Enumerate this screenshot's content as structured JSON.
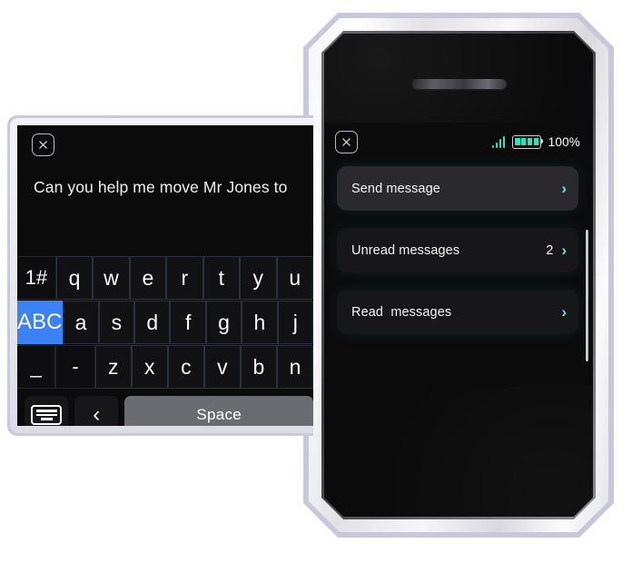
{
  "phone": {
    "status_bar": {
      "close_icon": "close-x-icon",
      "signal_icon": "signal-bars-icon",
      "battery_icon": "battery-full-icon",
      "battery_percent": "100%"
    },
    "menu": [
      {
        "label": "Send message",
        "count": "",
        "chevron": "›",
        "selected": true
      },
      {
        "label": "Unread messages",
        "count": "2",
        "chevron": "›",
        "selected": false
      },
      {
        "label": "Read  messages",
        "count": "",
        "chevron": "›",
        "selected": false
      }
    ]
  },
  "keyboard_panel": {
    "close_icon": "close-x-icon",
    "input_text": "Can you help me move Mr Jones to ",
    "rows": [
      {
        "keys": [
          {
            "label": "1#",
            "type": "mod"
          },
          {
            "label": "q",
            "type": "letter"
          },
          {
            "label": "w",
            "type": "letter"
          },
          {
            "label": "e",
            "type": "letter"
          },
          {
            "label": "r",
            "type": "letter"
          },
          {
            "label": "t",
            "type": "letter"
          },
          {
            "label": "y",
            "type": "letter"
          },
          {
            "label": "u",
            "type": "letter"
          }
        ]
      },
      {
        "keys": [
          {
            "label": "ABC",
            "type": "selected"
          },
          {
            "label": "a",
            "type": "letter"
          },
          {
            "label": "s",
            "type": "letter"
          },
          {
            "label": "d",
            "type": "letter"
          },
          {
            "label": "f",
            "type": "letter"
          },
          {
            "label": "g",
            "type": "letter"
          },
          {
            "label": "h",
            "type": "letter"
          },
          {
            "label": "j",
            "type": "letter"
          }
        ]
      },
      {
        "keys": [
          {
            "label": "_",
            "type": "underscore"
          },
          {
            "label": "-",
            "type": "mod"
          },
          {
            "label": "z",
            "type": "letter"
          },
          {
            "label": "x",
            "type": "letter"
          },
          {
            "label": "c",
            "type": "letter"
          },
          {
            "label": "v",
            "type": "letter"
          },
          {
            "label": "b",
            "type": "letter"
          },
          {
            "label": "n",
            "type": "letter"
          }
        ]
      }
    ],
    "bottom_row": {
      "keyboard_icon": "keyboard-icon",
      "back_label": "‹",
      "space_label": "Space"
    }
  },
  "colors": {
    "accent_blue": "#3b82f6",
    "accent_teal": "#5fe6e6",
    "battery_green": "#2fe3b8",
    "screen_black": "#0b0b0c",
    "frame_silver": "#e2e2e6"
  }
}
